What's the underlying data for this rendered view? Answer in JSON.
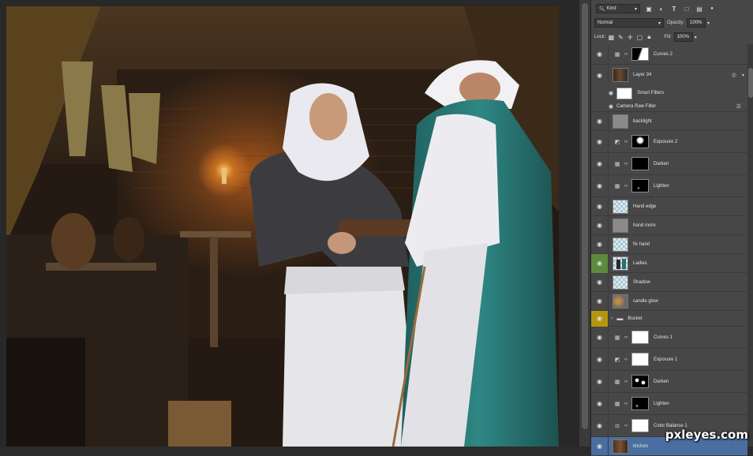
{
  "toolbar": {
    "filter_kind": "Kind",
    "blend_mode": "Normal",
    "opacity_label": "Opacity:",
    "opacity_value": "100%",
    "lock_label": "Lock:",
    "fill_label": "Fill:",
    "fill_value": "100%"
  },
  "layers": [
    {
      "name": "Curves 2",
      "type": "adjustment",
      "icon": "curves-icon",
      "mask": "curves2"
    },
    {
      "name": "Layer 34",
      "type": "smart-object",
      "thumb": "photo"
    },
    {
      "name": "Smart Filters",
      "type": "smart-filters"
    },
    {
      "name": "Camera Raw Filter",
      "type": "filter"
    },
    {
      "name": "backlight",
      "type": "pixel",
      "thumb": "gray"
    },
    {
      "name": "Exposure 2",
      "type": "adjustment",
      "icon": "exposure-icon",
      "mask": "exposure2"
    },
    {
      "name": "Darken",
      "type": "adjustment",
      "icon": "curves-icon",
      "mask": "black"
    },
    {
      "name": "Lighten",
      "type": "adjustment",
      "icon": "curves-icon",
      "mask": "black-dots"
    },
    {
      "name": "Hand edge",
      "type": "pixel",
      "thumb": "checker"
    },
    {
      "name": "hand more",
      "type": "pixel",
      "thumb": "gray"
    },
    {
      "name": "fix hand",
      "type": "pixel",
      "thumb": "checker"
    },
    {
      "name": "Ladies",
      "type": "pixel",
      "thumb": "ladies",
      "color": "#5d8a3c"
    },
    {
      "name": "Shadow",
      "type": "pixel",
      "thumb": "checker"
    },
    {
      "name": "candle glow",
      "type": "pixel",
      "thumb": "glow"
    },
    {
      "name": "Bucket",
      "type": "group",
      "color": "#b5960f"
    },
    {
      "name": "Curves 1",
      "type": "adjustment",
      "icon": "curves-icon",
      "mask": "white"
    },
    {
      "name": "Exposure 1",
      "type": "adjustment",
      "icon": "exposure-icon",
      "mask": "white"
    },
    {
      "name": "Darken",
      "type": "adjustment",
      "icon": "curves-icon",
      "mask": "spots"
    },
    {
      "name": "Lighten",
      "type": "adjustment",
      "icon": "curves-icon",
      "mask": "black-dots"
    },
    {
      "name": "Color Balance 1",
      "type": "adjustment",
      "icon": "balance-icon",
      "mask": "white"
    },
    {
      "name": "kitchen",
      "type": "pixel",
      "thumb": "photo",
      "color": "#4a6ea0"
    }
  ],
  "watermark": "pxleyes.com",
  "icons": {
    "eye": "eye-icon",
    "link": "link-icon",
    "folder": "folder-icon",
    "smart-object": "smart-object-icon"
  }
}
